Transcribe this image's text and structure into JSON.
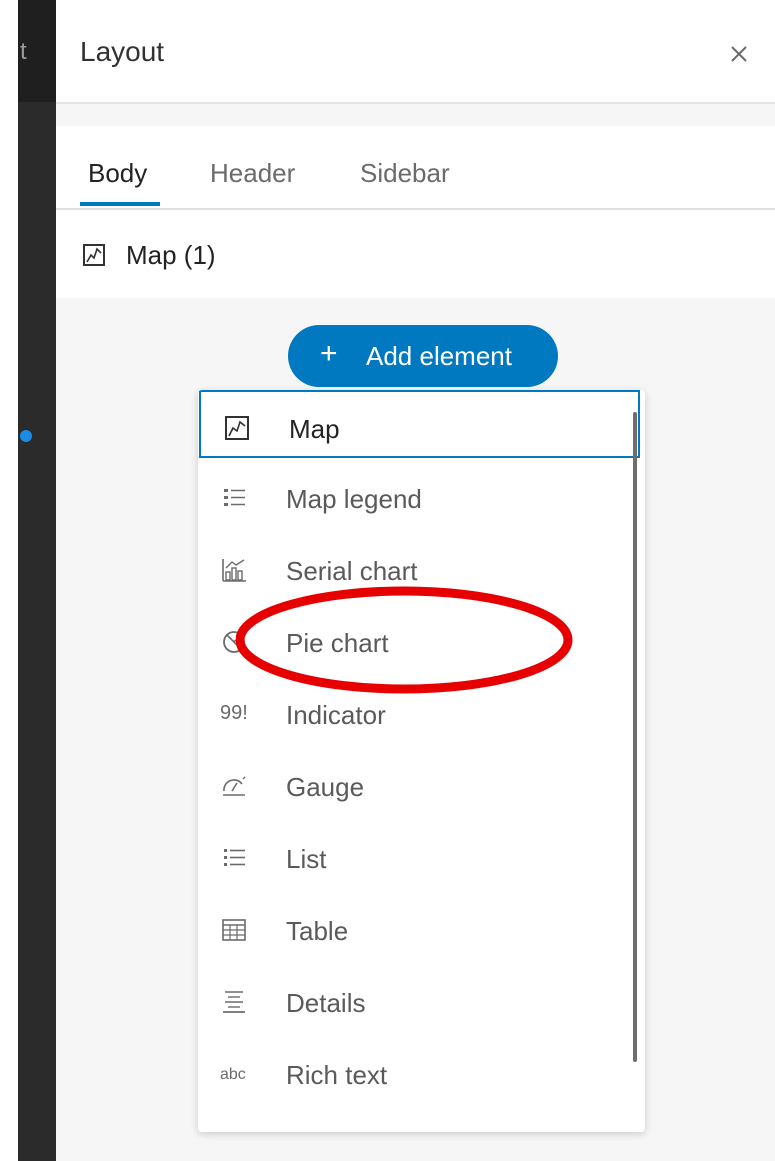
{
  "left_strip": {
    "truncated_text": "t"
  },
  "panel": {
    "title": "Layout",
    "close_label": "×"
  },
  "tabs": [
    {
      "label": "Body",
      "active": true
    },
    {
      "label": "Header",
      "active": false
    },
    {
      "label": "Sidebar",
      "active": false
    }
  ],
  "map_item": {
    "label": "Map (1)",
    "icon": "map-icon"
  },
  "add_button": {
    "plus": "+",
    "label": "Add element"
  },
  "menu": [
    {
      "label": "Map",
      "icon": "map-icon",
      "selected": true
    },
    {
      "label": "Map legend",
      "icon": "legend-icon"
    },
    {
      "label": "Serial chart",
      "icon": "serial-chart-icon"
    },
    {
      "label": "Pie chart",
      "icon": "pie-chart-icon"
    },
    {
      "label": "Indicator",
      "icon": "indicator-icon",
      "glyph": "99!"
    },
    {
      "label": "Gauge",
      "icon": "gauge-icon"
    },
    {
      "label": "List",
      "icon": "list-icon"
    },
    {
      "label": "Table",
      "icon": "table-icon"
    },
    {
      "label": "Details",
      "icon": "details-icon"
    },
    {
      "label": "Rich text",
      "icon": "rich-text-icon",
      "glyph": "abc"
    }
  ],
  "colors": {
    "accent": "#0079c1",
    "highlight": "#e60000"
  }
}
